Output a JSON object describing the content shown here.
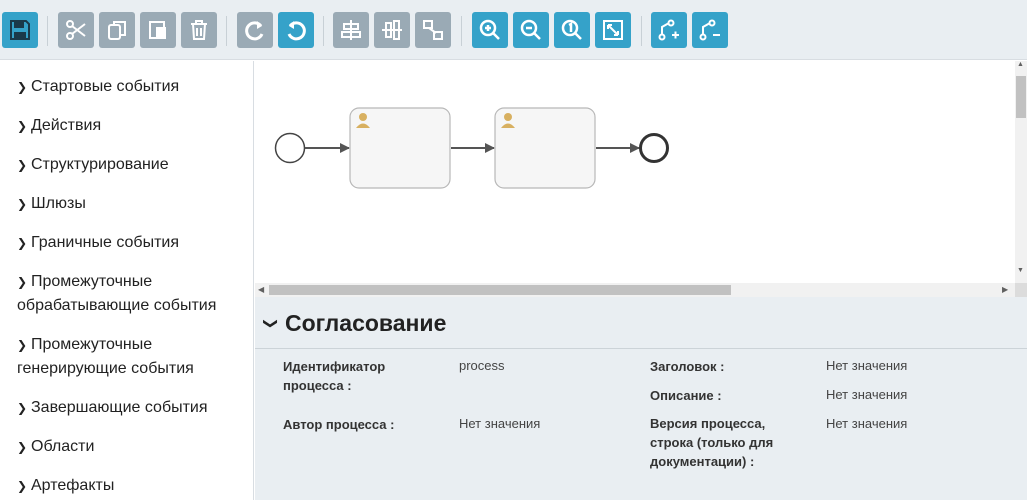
{
  "toolbar": {
    "buttons": [
      {
        "name": "save-icon",
        "tooltip": "Save"
      },
      {
        "name": "cut-icon"
      },
      {
        "name": "copy-icon"
      },
      {
        "name": "paste-icon"
      },
      {
        "name": "delete-icon"
      },
      {
        "name": "redo-icon"
      },
      {
        "name": "undo-icon"
      },
      {
        "name": "align-horizontal-icon"
      },
      {
        "name": "align-vertical-icon"
      },
      {
        "name": "distribute-icon"
      },
      {
        "name": "zoom-in-icon"
      },
      {
        "name": "zoom-out-icon"
      },
      {
        "name": "zoom-reset-icon"
      },
      {
        "name": "fit-screen-icon"
      },
      {
        "name": "add-bend-point-icon"
      },
      {
        "name": "remove-bend-point-icon"
      }
    ],
    "colors": {
      "gray": "#9aaab5",
      "blue": "#35a2c9"
    }
  },
  "sidebar": {
    "items": [
      {
        "label": "Стартовые события"
      },
      {
        "label": "Действия"
      },
      {
        "label": "Структурирование"
      },
      {
        "label": "Шлюзы"
      },
      {
        "label": "Граничные события"
      },
      {
        "label": "Промежуточные обрабатывающие события"
      },
      {
        "label": "Промежуточные генерирующие события"
      },
      {
        "label": "Завершающие события"
      },
      {
        "label": "Области"
      },
      {
        "label": "Артефакты"
      }
    ]
  },
  "diagram": {
    "elements": [
      "start-event",
      "user-task",
      "user-task",
      "end-event"
    ]
  },
  "properties": {
    "title": "Согласование",
    "fields": {
      "process_id_label": "Идентификатор процесса :",
      "process_id_value": "process",
      "author_label": "Автор процесса :",
      "author_value": "Нет значения",
      "header_label": "Заголовок :",
      "header_value": "Нет значения",
      "description_label": "Описание :",
      "description_value": "Нет значения",
      "version_label": "Версия процесса, строка (только для документации) :",
      "version_value": "Нет значения"
    }
  }
}
